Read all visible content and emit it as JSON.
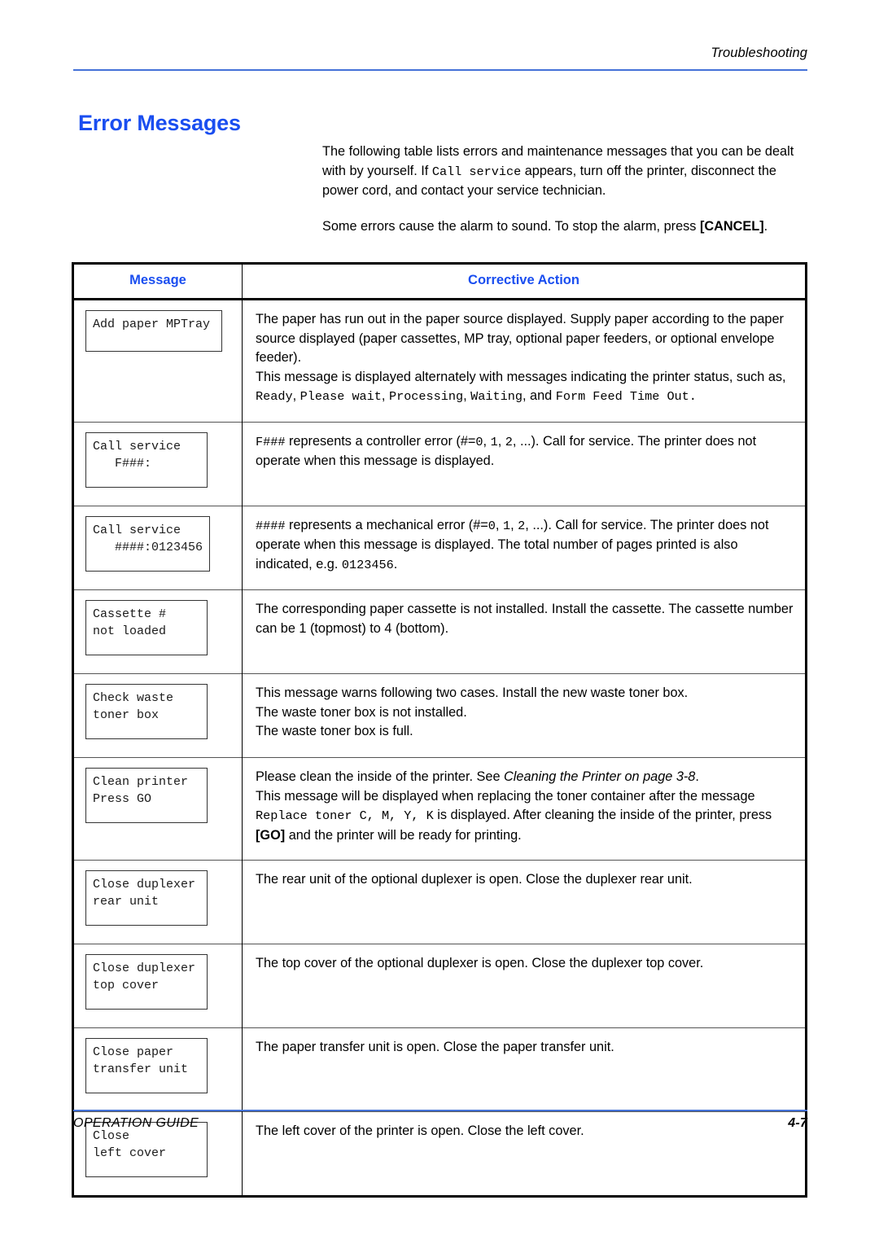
{
  "header": {
    "section_label": "Troubleshooting"
  },
  "page_title": "Error Messages",
  "intro": {
    "paragraph1_a": "The following table lists errors and maintenance messages that you can be dealt with by yourself. If ",
    "paragraph1_mono": "Call service",
    "paragraph1_b": " appears, turn off the printer, disconnect the power cord, and contact your service technician.",
    "paragraph2_a": "Some errors cause the alarm to sound. To stop the alarm, press ",
    "paragraph2_key": "[CANCEL]",
    "paragraph2_b": "."
  },
  "table": {
    "headers": {
      "message": "Message",
      "corrective_action": "Corrective Action"
    },
    "rows": [
      {
        "message": "Add paper MPTray",
        "action_lines": [
          {
            "type": "mixed",
            "parts": [
              {
                "t": "plain",
                "v": "The paper has run out in the paper source displayed. Supply paper according to the paper source displayed (paper cassettes, MP tray, optional paper feeders, or optional envelope feeder)."
              }
            ]
          },
          {
            "type": "mixed",
            "parts": [
              {
                "t": "plain",
                "v": "This message is displayed alternately with messages indicating the printer status, such as, "
              },
              {
                "t": "mono",
                "v": "Ready"
              },
              {
                "t": "plain",
                "v": ", "
              },
              {
                "t": "mono",
                "v": "Please wait"
              },
              {
                "t": "plain",
                "v": ", "
              },
              {
                "t": "mono",
                "v": "Processing"
              },
              {
                "t": "plain",
                "v": ", "
              },
              {
                "t": "mono",
                "v": "Waiting"
              },
              {
                "t": "plain",
                "v": ", and "
              },
              {
                "t": "mono",
                "v": "Form Feed Time Out"
              },
              {
                "t": "mono",
                "v": "."
              }
            ]
          }
        ]
      },
      {
        "message": "Call service\n   F###:",
        "action_lines": [
          {
            "type": "mixed",
            "parts": [
              {
                "t": "mono",
                "v": "F###"
              },
              {
                "t": "plain",
                "v": " represents a controller error (#="
              },
              {
                "t": "mono",
                "v": "0"
              },
              {
                "t": "plain",
                "v": ", "
              },
              {
                "t": "mono",
                "v": "1"
              },
              {
                "t": "plain",
                "v": ", "
              },
              {
                "t": "mono",
                "v": "2"
              },
              {
                "t": "plain",
                "v": ", ...). Call for service. The printer does not operate when this message is displayed."
              }
            ]
          }
        ]
      },
      {
        "message": "Call service\n   ####:0123456",
        "action_lines": [
          {
            "type": "mixed",
            "parts": [
              {
                "t": "mono",
                "v": "####"
              },
              {
                "t": "plain",
                "v": " represents a mechanical error (#="
              },
              {
                "t": "mono",
                "v": "0"
              },
              {
                "t": "plain",
                "v": ", "
              },
              {
                "t": "mono",
                "v": "1"
              },
              {
                "t": "plain",
                "v": ", "
              },
              {
                "t": "mono",
                "v": "2"
              },
              {
                "t": "plain",
                "v": ", ...). Call for service. The printer does not operate when this message is displayed. The total number of pages printed is also indicated, e.g. "
              },
              {
                "t": "mono",
                "v": "0123456"
              },
              {
                "t": "plain",
                "v": "."
              }
            ]
          }
        ]
      },
      {
        "message": "Cassette #\nnot loaded",
        "action_lines": [
          {
            "type": "mixed",
            "parts": [
              {
                "t": "plain",
                "v": "The corresponding paper cassette is not installed. Install the cassette. The cassette number can be 1 (topmost) to 4 (bottom)."
              }
            ]
          }
        ]
      },
      {
        "message": "Check waste\ntoner box",
        "action_lines": [
          {
            "type": "mixed",
            "parts": [
              {
                "t": "plain",
                "v": "This message warns following two cases. Install the new waste toner box."
              }
            ]
          },
          {
            "type": "mixed",
            "parts": [
              {
                "t": "plain",
                "v": "The waste toner box is not installed."
              }
            ]
          },
          {
            "type": "mixed",
            "parts": [
              {
                "t": "plain",
                "v": "The waste toner box is full."
              }
            ]
          }
        ]
      },
      {
        "message": "Clean printer\nPress GO",
        "action_lines": [
          {
            "type": "mixed",
            "parts": [
              {
                "t": "plain",
                "v": "Please clean the inside of the printer. See "
              },
              {
                "t": "ital",
                "v": "Cleaning the Printer on page 3-8"
              },
              {
                "t": "plain",
                "v": "."
              }
            ]
          },
          {
            "type": "mixed",
            "parts": [
              {
                "t": "plain",
                "v": "This message will be displayed when replacing the toner container after the message "
              },
              {
                "t": "mono",
                "v": "Replace toner C, M, Y, K"
              },
              {
                "t": "plain",
                "v": " is displayed. After cleaning the inside of the printer, press "
              },
              {
                "t": "key",
                "v": "[GO]"
              },
              {
                "t": "plain",
                "v": " and the printer will be ready for printing."
              }
            ]
          }
        ]
      },
      {
        "message": "Close duplexer\nrear unit",
        "action_lines": [
          {
            "type": "mixed",
            "parts": [
              {
                "t": "plain",
                "v": "The rear unit of the optional duplexer is open. Close the duplexer rear unit."
              }
            ]
          }
        ]
      },
      {
        "message": "Close duplexer\ntop cover",
        "action_lines": [
          {
            "type": "mixed",
            "parts": [
              {
                "t": "plain",
                "v": "The top cover of the optional duplexer is open. Close the duplexer top cover."
              }
            ]
          }
        ]
      },
      {
        "message": "Close paper\ntransfer unit",
        "action_lines": [
          {
            "type": "mixed",
            "parts": [
              {
                "t": "plain",
                "v": "The paper transfer unit is open. Close the paper transfer unit."
              }
            ]
          }
        ]
      },
      {
        "message": "Close\nleft cover",
        "action_lines": [
          {
            "type": "mixed",
            "parts": [
              {
                "t": "plain",
                "v": "The left cover of the printer is open. Close the left cover."
              }
            ]
          }
        ]
      }
    ]
  },
  "footer": {
    "guide_label": "OPERATION GUIDE",
    "page_number": "4-7"
  },
  "colors": {
    "heading_blue": "#1a4ef0",
    "rule_blue": "#4472d8",
    "text_black": "#000000"
  }
}
